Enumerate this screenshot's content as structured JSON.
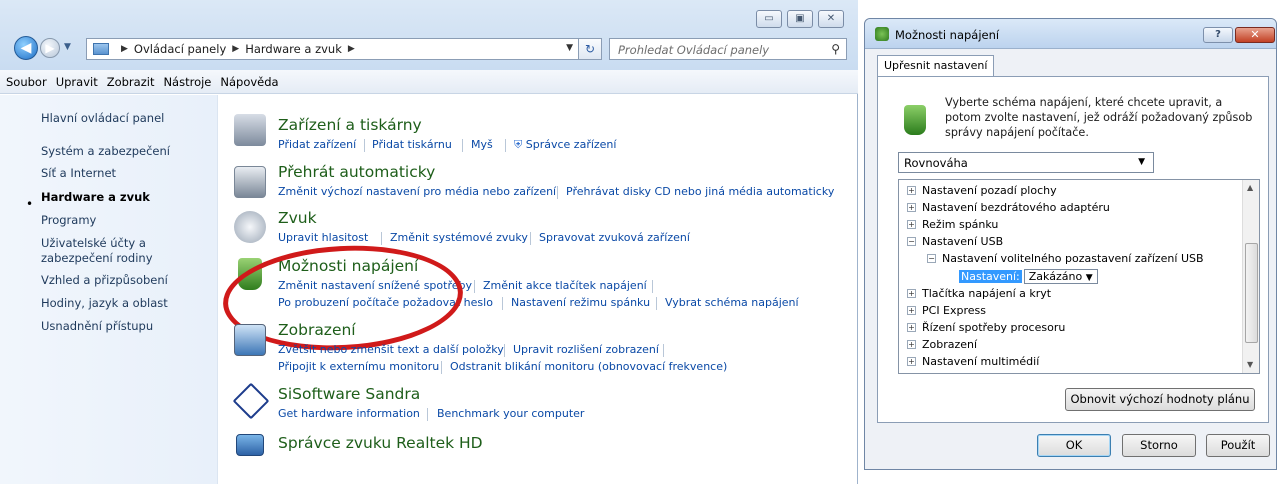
{
  "explorer": {
    "address": [
      "Ovládací panely",
      "Hardware a zvuk"
    ],
    "search_placeholder": "Prohledat Ovládací panely",
    "menu": [
      "Soubor",
      "Upravit",
      "Zobrazit",
      "Nástroje",
      "Nápověda"
    ],
    "sidebar": [
      "Hlavní ovládací panel",
      "Systém a zabezpečení",
      "Síť a Internet",
      "Hardware a zvuk",
      "Programy",
      "Uživatelské účty a zabezpečení rodiny",
      "Vzhled a přizpůsobení",
      "Hodiny, jazyk a oblast",
      "Usnadnění přístupu"
    ],
    "categories": [
      {
        "title": "Zařízení a tiskárny",
        "links": [
          "Přidat zařízení",
          "Přidat tiskárnu",
          "Myš",
          "Správce zařízení"
        ]
      },
      {
        "title": "Přehrát automaticky",
        "links": [
          "Změnit výchozí nastavení pro média nebo zařízení",
          "Přehrávat disky CD nebo jiná média automaticky"
        ]
      },
      {
        "title": "Zvuk",
        "links": [
          "Upravit hlasitost",
          "Změnit systémové zvuky",
          "Spravovat zvuková zařízení"
        ]
      },
      {
        "title": "Možnosti napájení",
        "links": [
          "Změnit nastavení snížené spotřeby",
          "Změnit akce tlačítek napájení",
          "Po probuzení počítače požadovat heslo",
          "Nastavení režimu spánku",
          "Vybrat schéma napájení"
        ]
      },
      {
        "title": "Zobrazení",
        "links": [
          "Zvětšit nebo zmenšit text a další položky",
          "Upravit rozlišení zobrazení",
          "Připojit k externímu monitoru",
          "Odstranit blikání monitoru (obnovovací frekvence)"
        ]
      },
      {
        "title": "SiSoftware Sandra",
        "links": [
          "Get hardware information",
          "Benchmark your computer"
        ]
      },
      {
        "title": "Správce zvuku Realtek HD",
        "links": []
      }
    ]
  },
  "dialog": {
    "title": "Možnosti napájení",
    "tab": "Upřesnit nastavení",
    "description": "Vyberte schéma napájení, které chcete upravit, a potom zvolte nastavení, jež odráží požadovaný způsob správy napájení počítače.",
    "scheme": "Rovnováha",
    "tree": [
      "Nastavení pozadí plochy",
      "Nastavení bezdrátového adaptéru",
      "Režim spánku",
      "Nastavení USB",
      "Nastavení volitelného pozastavení zařízení USB",
      "Tlačítka napájení a kryt",
      "PCI Express",
      "Řízení spotřeby procesoru",
      "Zobrazení",
      "Nastavení multimédií"
    ],
    "setting_label": "Nastavení:",
    "setting_value": "Zakázáno",
    "restore_button": "Obnovit výchozí hodnoty plánu",
    "ok": "OK",
    "cancel": "Storno",
    "apply": "Použít"
  },
  "colors": {
    "link": "#0a49a6",
    "category_title": "#1e5e1a",
    "highlight": "#d01a1a"
  }
}
